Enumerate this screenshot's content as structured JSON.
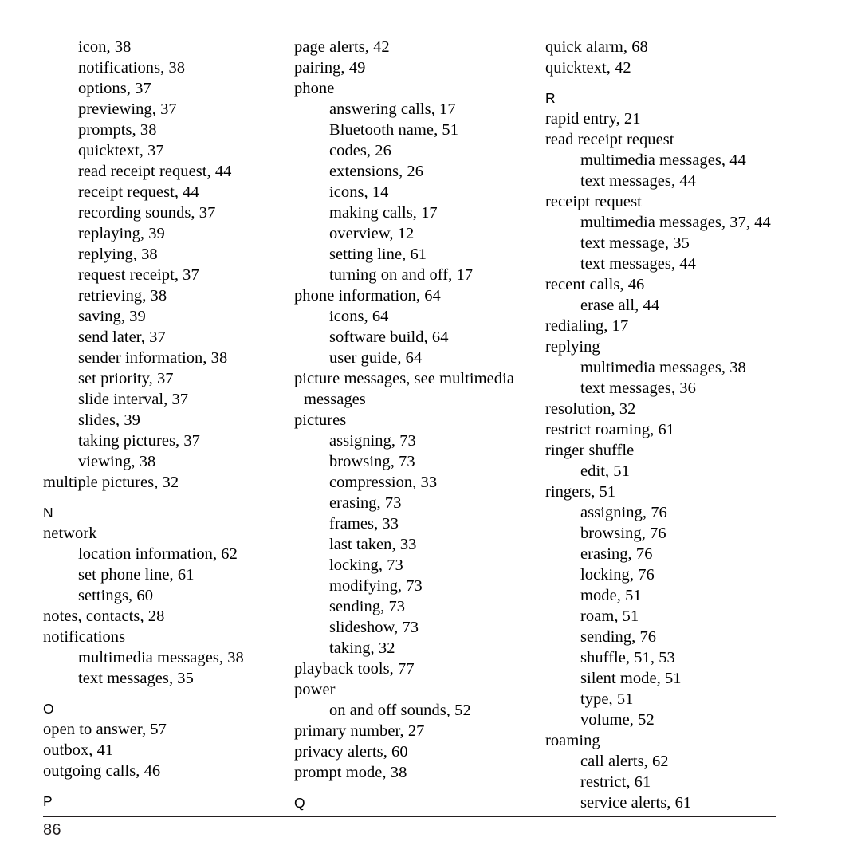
{
  "document": {
    "type": "index",
    "page_number": "86"
  },
  "columns": [
    {
      "id": "column-1",
      "lines": [
        {
          "kind": "entry",
          "level": 2,
          "text": "icon, 38"
        },
        {
          "kind": "entry",
          "level": 2,
          "text": "notifications, 38"
        },
        {
          "kind": "entry",
          "level": 2,
          "text": "options, 37"
        },
        {
          "kind": "entry",
          "level": 2,
          "text": "previewing, 37"
        },
        {
          "kind": "entry",
          "level": 2,
          "text": "prompts, 38"
        },
        {
          "kind": "entry",
          "level": 2,
          "text": "quicktext, 37"
        },
        {
          "kind": "entry",
          "level": 2,
          "text": "read receipt request, 44"
        },
        {
          "kind": "entry",
          "level": 2,
          "text": "receipt request, 44"
        },
        {
          "kind": "entry",
          "level": 2,
          "text": "recording sounds, 37"
        },
        {
          "kind": "entry",
          "level": 2,
          "text": "replaying, 39"
        },
        {
          "kind": "entry",
          "level": 2,
          "text": "replying, 38"
        },
        {
          "kind": "entry",
          "level": 2,
          "text": "request receipt, 37"
        },
        {
          "kind": "entry",
          "level": 2,
          "text": "retrieving, 38"
        },
        {
          "kind": "entry",
          "level": 2,
          "text": "saving, 39"
        },
        {
          "kind": "entry",
          "level": 2,
          "text": "send later, 37"
        },
        {
          "kind": "entry",
          "level": 2,
          "text": "sender information, 38"
        },
        {
          "kind": "entry",
          "level": 2,
          "text": "set priority, 37"
        },
        {
          "kind": "entry",
          "level": 2,
          "text": "slide interval, 37"
        },
        {
          "kind": "entry",
          "level": 2,
          "text": "slides, 39"
        },
        {
          "kind": "entry",
          "level": 2,
          "text": "taking pictures, 37"
        },
        {
          "kind": "entry",
          "level": 2,
          "text": "viewing, 38"
        },
        {
          "kind": "entry",
          "level": 1,
          "text": "multiple pictures, 32"
        },
        {
          "kind": "letter",
          "text": "N"
        },
        {
          "kind": "entry",
          "level": 1,
          "text": "network"
        },
        {
          "kind": "entry",
          "level": 2,
          "text": "location information, 62"
        },
        {
          "kind": "entry",
          "level": 2,
          "text": "set phone line, 61"
        },
        {
          "kind": "entry",
          "level": 2,
          "text": "settings, 60"
        },
        {
          "kind": "entry",
          "level": 1,
          "text": "notes, contacts, 28"
        },
        {
          "kind": "entry",
          "level": 1,
          "text": "notifications"
        },
        {
          "kind": "entry",
          "level": 2,
          "text": "multimedia messages, 38"
        },
        {
          "kind": "entry",
          "level": 2,
          "text": "text messages, 35"
        },
        {
          "kind": "letter",
          "text": "O"
        },
        {
          "kind": "entry",
          "level": 1,
          "text": "open to answer, 57"
        },
        {
          "kind": "entry",
          "level": 1,
          "text": "outbox, 41"
        },
        {
          "kind": "entry",
          "level": 1,
          "text": "outgoing calls, 46"
        },
        {
          "kind": "letter",
          "text": "P"
        }
      ]
    },
    {
      "id": "column-2",
      "lines": [
        {
          "kind": "entry",
          "level": 1,
          "text": "page alerts, 42"
        },
        {
          "kind": "entry",
          "level": 1,
          "text": "pairing, 49"
        },
        {
          "kind": "entry",
          "level": 1,
          "text": "phone"
        },
        {
          "kind": "entry",
          "level": 2,
          "text": "answering calls, 17"
        },
        {
          "kind": "entry",
          "level": 2,
          "text": "Bluetooth name, 51"
        },
        {
          "kind": "entry",
          "level": 2,
          "text": "codes, 26"
        },
        {
          "kind": "entry",
          "level": 2,
          "text": "extensions, 26"
        },
        {
          "kind": "entry",
          "level": 2,
          "text": "icons, 14"
        },
        {
          "kind": "entry",
          "level": 2,
          "text": "making calls, 17"
        },
        {
          "kind": "entry",
          "level": 2,
          "text": "overview, 12"
        },
        {
          "kind": "entry",
          "level": 2,
          "text": "setting line, 61"
        },
        {
          "kind": "entry",
          "level": 2,
          "text": "turning on and off, 17"
        },
        {
          "kind": "entry",
          "level": 1,
          "text": "phone information, 64"
        },
        {
          "kind": "entry",
          "level": 2,
          "text": "icons, 64"
        },
        {
          "kind": "entry",
          "level": 2,
          "text": "software build, 64"
        },
        {
          "kind": "entry",
          "level": 2,
          "text": "user guide, 64"
        },
        {
          "kind": "entry",
          "level": 1,
          "text": "picture messages, see multimedia"
        },
        {
          "kind": "entry",
          "level": 1,
          "wrap": true,
          "text": "messages"
        },
        {
          "kind": "entry",
          "level": 1,
          "text": "pictures"
        },
        {
          "kind": "entry",
          "level": 2,
          "text": "assigning, 73"
        },
        {
          "kind": "entry",
          "level": 2,
          "text": "browsing, 73"
        },
        {
          "kind": "entry",
          "level": 2,
          "text": "compression, 33"
        },
        {
          "kind": "entry",
          "level": 2,
          "text": "erasing, 73"
        },
        {
          "kind": "entry",
          "level": 2,
          "text": "frames, 33"
        },
        {
          "kind": "entry",
          "level": 2,
          "text": "last taken, 33"
        },
        {
          "kind": "entry",
          "level": 2,
          "text": "locking, 73"
        },
        {
          "kind": "entry",
          "level": 2,
          "text": "modifying, 73"
        },
        {
          "kind": "entry",
          "level": 2,
          "text": "sending, 73"
        },
        {
          "kind": "entry",
          "level": 2,
          "text": "slideshow, 73"
        },
        {
          "kind": "entry",
          "level": 2,
          "text": "taking, 32"
        },
        {
          "kind": "entry",
          "level": 1,
          "text": "playback tools, 77"
        },
        {
          "kind": "entry",
          "level": 1,
          "text": "power"
        },
        {
          "kind": "entry",
          "level": 2,
          "text": "on and off sounds, 52"
        },
        {
          "kind": "entry",
          "level": 1,
          "text": "primary number, 27"
        },
        {
          "kind": "entry",
          "level": 1,
          "text": "privacy alerts, 60"
        },
        {
          "kind": "entry",
          "level": 1,
          "text": "prompt mode, 38"
        },
        {
          "kind": "letter",
          "text": "Q"
        }
      ]
    },
    {
      "id": "column-3",
      "lines": [
        {
          "kind": "entry",
          "level": 1,
          "text": "quick alarm, 68"
        },
        {
          "kind": "entry",
          "level": 1,
          "text": "quicktext, 42"
        },
        {
          "kind": "letter",
          "text": "R"
        },
        {
          "kind": "entry",
          "level": 1,
          "text": "rapid entry, 21"
        },
        {
          "kind": "entry",
          "level": 1,
          "text": "read receipt request"
        },
        {
          "kind": "entry",
          "level": 2,
          "text": "multimedia messages, 44"
        },
        {
          "kind": "entry",
          "level": 2,
          "text": "text messages, 44"
        },
        {
          "kind": "entry",
          "level": 1,
          "text": "receipt request"
        },
        {
          "kind": "entry",
          "level": 2,
          "text": "multimedia messages, 37, 44"
        },
        {
          "kind": "entry",
          "level": 2,
          "text": "text message, 35"
        },
        {
          "kind": "entry",
          "level": 2,
          "text": "text messages, 44"
        },
        {
          "kind": "entry",
          "level": 1,
          "text": "recent calls, 46"
        },
        {
          "kind": "entry",
          "level": 2,
          "text": "erase all, 44"
        },
        {
          "kind": "entry",
          "level": 1,
          "text": "redialing, 17"
        },
        {
          "kind": "entry",
          "level": 1,
          "text": "replying"
        },
        {
          "kind": "entry",
          "level": 2,
          "text": "multimedia messages, 38"
        },
        {
          "kind": "entry",
          "level": 2,
          "text": "text messages, 36"
        },
        {
          "kind": "entry",
          "level": 1,
          "text": "resolution, 32"
        },
        {
          "kind": "entry",
          "level": 1,
          "text": "restrict roaming, 61"
        },
        {
          "kind": "entry",
          "level": 1,
          "text": "ringer shuffle"
        },
        {
          "kind": "entry",
          "level": 2,
          "text": "edit, 51"
        },
        {
          "kind": "entry",
          "level": 1,
          "text": "ringers, 51"
        },
        {
          "kind": "entry",
          "level": 2,
          "text": "assigning, 76"
        },
        {
          "kind": "entry",
          "level": 2,
          "text": "browsing, 76"
        },
        {
          "kind": "entry",
          "level": 2,
          "text": "erasing, 76"
        },
        {
          "kind": "entry",
          "level": 2,
          "text": "locking, 76"
        },
        {
          "kind": "entry",
          "level": 2,
          "text": "mode, 51"
        },
        {
          "kind": "entry",
          "level": 2,
          "text": "roam, 51"
        },
        {
          "kind": "entry",
          "level": 2,
          "text": "sending, 76"
        },
        {
          "kind": "entry",
          "level": 2,
          "text": "shuffle, 51, 53"
        },
        {
          "kind": "entry",
          "level": 2,
          "text": "silent mode, 51"
        },
        {
          "kind": "entry",
          "level": 2,
          "text": "type, 51"
        },
        {
          "kind": "entry",
          "level": 2,
          "text": "volume, 52"
        },
        {
          "kind": "entry",
          "level": 1,
          "text": "roaming"
        },
        {
          "kind": "entry",
          "level": 2,
          "text": "call alerts, 62"
        },
        {
          "kind": "entry",
          "level": 2,
          "text": "restrict, 61"
        },
        {
          "kind": "entry",
          "level": 2,
          "text": "service alerts, 61"
        }
      ]
    }
  ]
}
